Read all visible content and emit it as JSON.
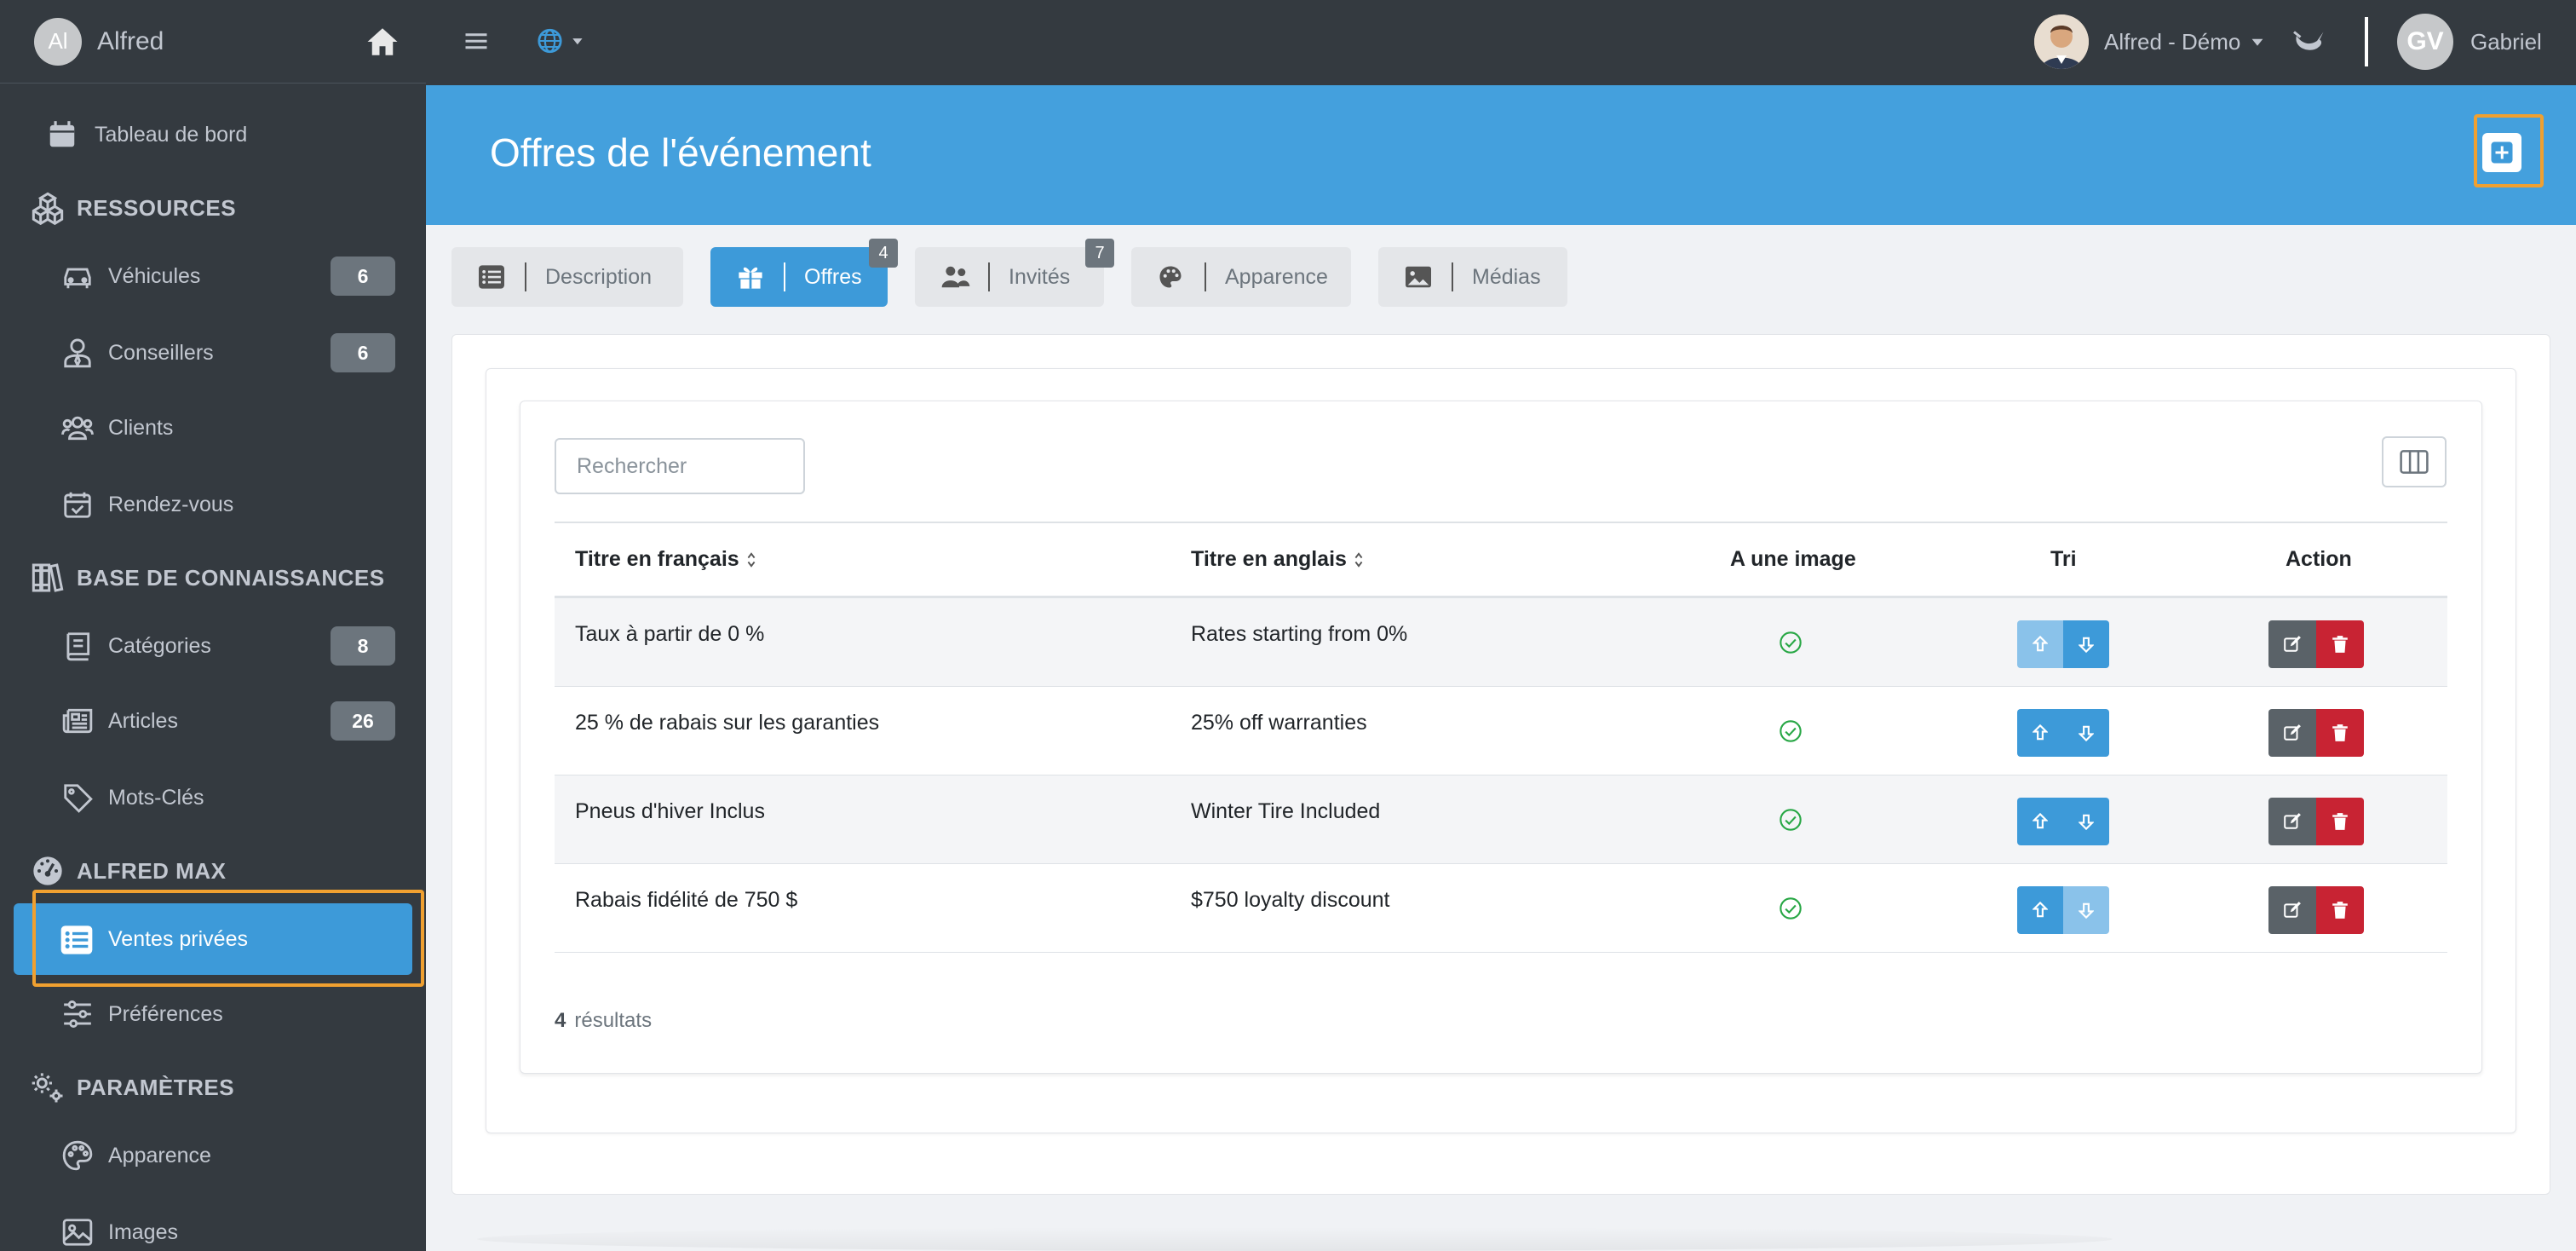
{
  "sidebar": {
    "brand": {
      "avatar": "Al",
      "name": "Alfred",
      "icon": "home-icon"
    },
    "dashboard": {
      "label": "Tableau de bord",
      "icon": "calendar-icon"
    },
    "sections": {
      "ressources": {
        "label": "RESSOURCES",
        "icon": "cubes-icon"
      },
      "base": {
        "label": "BASE DE CONNAISSANCES",
        "icon": "books-icon"
      },
      "alfred_max": {
        "label": "ALFRED MAX",
        "icon": "tachometer-icon"
      },
      "parametres": {
        "label": "PARAMÈTRES",
        "icon": "cogs-icon"
      }
    },
    "items": {
      "vehicules": {
        "label": "Véhicules",
        "badge": "6",
        "icon": "car-icon"
      },
      "conseillers": {
        "label": "Conseillers",
        "badge": "6",
        "icon": "user-tie-icon"
      },
      "clients": {
        "label": "Clients",
        "icon": "users-icon"
      },
      "rendezvous": {
        "label": "Rendez-vous",
        "icon": "calendar-check-icon"
      },
      "categories": {
        "label": "Catégories",
        "badge": "8",
        "icon": "book-icon"
      },
      "articles": {
        "label": "Articles",
        "badge": "26",
        "icon": "newspaper-icon"
      },
      "motscles": {
        "label": "Mots-Clés",
        "icon": "tag-icon"
      },
      "ventes": {
        "label": "Ventes privées",
        "icon": "list-icon"
      },
      "preferences": {
        "label": "Préférences",
        "icon": "sliders-icon"
      },
      "apparence": {
        "label": "Apparence",
        "icon": "palette-icon"
      },
      "images": {
        "label": "Images",
        "icon": "image-icon"
      }
    }
  },
  "topbar": {
    "menu_icon": "hamburger-icon",
    "language_icon": "globe-icon",
    "account": {
      "label": "Alfred - Démo"
    },
    "user": {
      "initials": "GV",
      "name": "Gabriel"
    }
  },
  "page": {
    "title": "Offres de l'événement",
    "add_icon": "plus-icon"
  },
  "tabs": [
    {
      "label": "Description",
      "icon": "list-icon"
    },
    {
      "label": "Offres",
      "icon": "gift-icon",
      "count": "4",
      "active": true
    },
    {
      "label": "Invités",
      "icon": "users-icon",
      "count": "7"
    },
    {
      "label": "Apparence",
      "icon": "palette-icon"
    },
    {
      "label": "Médias",
      "icon": "image-icon"
    }
  ],
  "table": {
    "search_placeholder": "Rechercher",
    "columns": [
      "Titre en français",
      "Titre en anglais",
      "A une image",
      "Tri",
      "Action"
    ],
    "rows": [
      {
        "fr": "Taux à partir de 0 %",
        "en": "Rates starting from 0%",
        "has_image": true
      },
      {
        "fr": "25 % de rabais sur les garanties",
        "en": "25% off warranties",
        "has_image": true
      },
      {
        "fr": "Pneus d'hiver Inclus",
        "en": "Winter Tire Included",
        "has_image": true
      },
      {
        "fr": "Rabais fidélité de 750 $",
        "en": "$750 loyalty discount",
        "has_image": true
      }
    ],
    "results_count": "4",
    "results_label": "résultats"
  },
  "colors": {
    "sidebar_bg": "#343a40",
    "primary": "#3d9ad9",
    "header_bg": "#44a0dd",
    "danger": "#c82333",
    "success": "#28a745",
    "highlight": "#f0a030"
  }
}
